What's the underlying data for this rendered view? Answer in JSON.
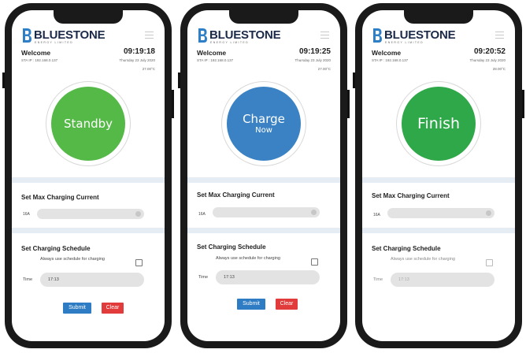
{
  "brand": {
    "name": "BLUESTONE",
    "tagline": "ENERGY LIMITED"
  },
  "colors": {
    "standby": "#55b947",
    "charge": "#3a82c4",
    "finish": "#2ea848",
    "submit": "#2e7cc4",
    "clear": "#e23b3b"
  },
  "icons": {
    "menu": "hamburger-menu-icon",
    "logo": "bluestone-logo-icon"
  },
  "screens": [
    {
      "welcome": "Welcome",
      "ip": "STA IP : 192.168.0.137",
      "time": "09:19:18",
      "date": "Thursday 23 July 2020",
      "temp": "27.00°C",
      "status": {
        "main": "Standby",
        "sub": ""
      },
      "max_current": {
        "label": "Set Max Charging Current",
        "value": "16A"
      },
      "schedule": {
        "label": "Set Charging Schedule",
        "checkbox_text": "Always use schedule for charging",
        "time_label": "Time",
        "time_value": "17:13"
      },
      "buttons": {
        "submit": "Submit",
        "clear": "Clear"
      }
    },
    {
      "welcome": "Welcome",
      "ip": "STA IP : 192.168.0.137",
      "time": "09:19:25",
      "date": "Thursday 23 July 2020",
      "temp": "27.00°C",
      "status": {
        "main": "Charge",
        "sub": "Now"
      },
      "max_current": {
        "label": "Set Max Charging Current",
        "value": "16A"
      },
      "schedule": {
        "label": "Set Charging Schedule",
        "checkbox_text": "Always use schedule for charging",
        "time_label": "Time",
        "time_value": "17:13"
      },
      "buttons": {
        "submit": "Submit",
        "clear": "Clear"
      }
    },
    {
      "welcome": "Welcome",
      "ip": "STA IP : 192.168.0.137",
      "time": "09:20:52",
      "date": "Thursday 23 July 2020",
      "temp": "28.00°C",
      "status": {
        "main": "Finish",
        "sub": ""
      },
      "max_current": {
        "label": "Set Max Charging Current",
        "value": "16A"
      },
      "schedule": {
        "label": "Set Charging Schedule",
        "checkbox_text": "Always use schedule for charging",
        "time_label": "Time",
        "time_value": "17:13"
      }
    }
  ]
}
